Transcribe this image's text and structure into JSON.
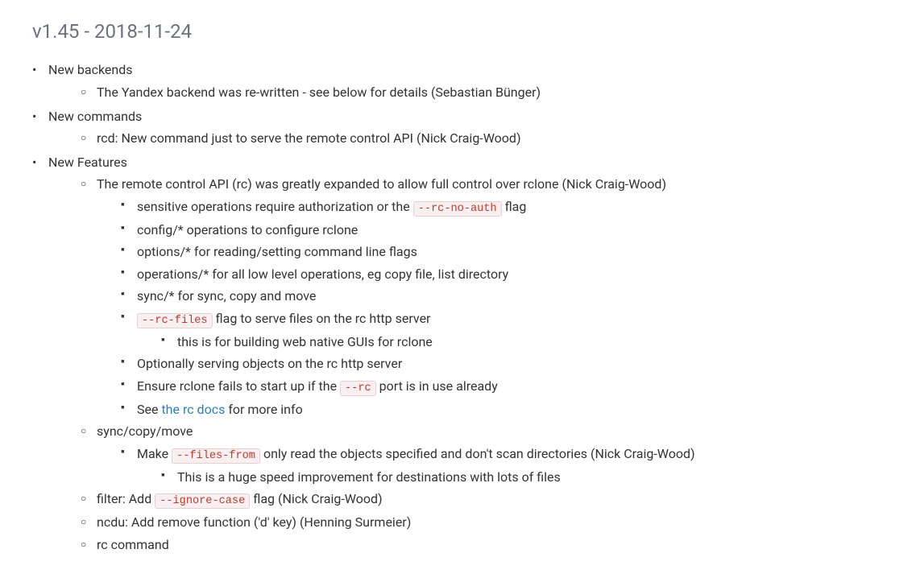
{
  "version": {
    "title": "v1.45 - 2018-11-24"
  },
  "sections": [
    {
      "label": "New backends",
      "items": [
        {
          "text": "The Yandex backend was re-written - see below for details (Sebastian Bünger)"
        }
      ]
    },
    {
      "label": "New commands",
      "items": [
        {
          "text": "rcd: New command just to serve the remote control API (Nick Craig-Wood)"
        }
      ]
    },
    {
      "label": "New Features",
      "items": [
        {
          "text_before": "The remote control API (rc) was greatly expanded to allow full control over rclone (Nick Craig-Wood)",
          "sub_items": [
            {
              "text_before": "sensitive operations require authorization or the ",
              "code": "--rc-no-auth",
              "text_after": " flag"
            },
            {
              "text_before": "config/* operations to configure rclone"
            },
            {
              "text_before": "options/* for reading/setting command line flags"
            },
            {
              "text_before": "operations/* for all low level operations, eg copy file, list directory"
            },
            {
              "text_before": "sync/* for sync, copy and move"
            },
            {
              "code": "--rc-files",
              "text_after": " flag to serve files on the rc http server",
              "sub_items": [
                {
                  "text": "this is for building web native GUIs for rclone"
                }
              ]
            },
            {
              "text_before": "Optionally serving objects on the rc http server"
            },
            {
              "text_before": "Ensure rclone fails to start up if the ",
              "code": "--rc",
              "text_after": " port is in use already"
            },
            {
              "text_before": "See ",
              "link_text": "the rc docs",
              "link_href": "#",
              "text_after": " for more info"
            }
          ]
        },
        {
          "text_before": "sync/copy/move",
          "sub_items": [
            {
              "text_before": "Make ",
              "code": "--files-from",
              "text_after": " only read the objects specified and don't scan directories (Nick Craig-Wood)",
              "sub_items": [
                {
                  "text": "This is a huge speed improvement for destinations with lots of files"
                }
              ]
            }
          ]
        },
        {
          "text_before": "filter: Add ",
          "code": "--ignore-case",
          "text_after": " flag (Nick Craig-Wood)"
        },
        {
          "text_before": "ncdu: Add remove function ('d' key) (Henning Surmeier)"
        },
        {
          "text_before": "rc command"
        }
      ]
    }
  ]
}
